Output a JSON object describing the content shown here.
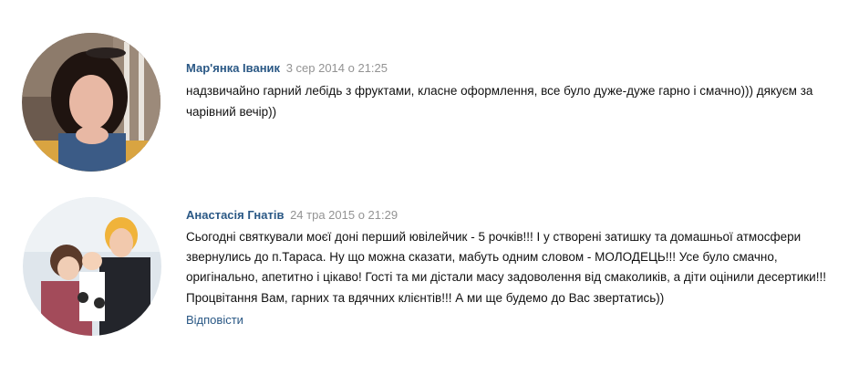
{
  "comments": [
    {
      "author": "Мар'янка Іваник",
      "date": "3 сер 2014 о 21:25",
      "text": "надзвичайно гарний лебідь з фруктами, класне оформлення, все було дуже-дуже гарно і смачно))) дякуєм за чарівний вечір))"
    },
    {
      "author": "Анастасія Гнатів",
      "date": "24 тра 2015 о 21:29",
      "text": "Сьогодні святкували моєї доні перший ювілейчик - 5 рочків!!! І у створені затишку та домашньої атмосфери звернулись до п.Тараса. Ну що можна сказати, мабуть одним словом - МОЛОДЕЦЬ!!! Усе було смачно, оригінально, апетитно і цікаво! Гості та ми дістали масу задоволення від смаколиків, а діти оцінили десертики!!! Процвітання Вам, гарних та вдячних клієнтів!!! А ми ще будемо до Вас звертатись))",
      "reply_label": "Відповісти"
    }
  ],
  "colors": {
    "link": "#2a5885",
    "date": "#939393",
    "text": "#111111"
  }
}
